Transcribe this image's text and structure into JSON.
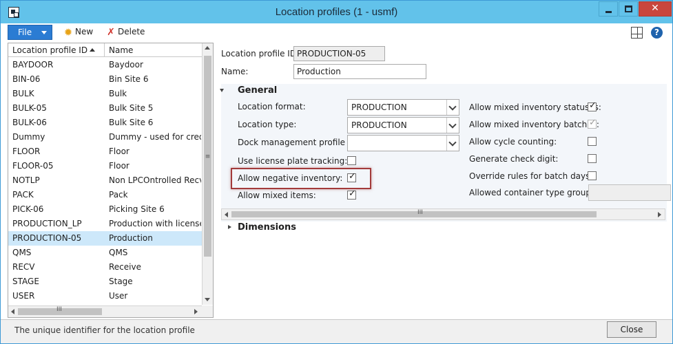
{
  "window": {
    "title": "Location profiles (1 - usmf)",
    "controls": {
      "close_symbol": "✕"
    }
  },
  "toolbar": {
    "file_label": "File",
    "new_label": "New",
    "delete_label": "Delete",
    "new_icon": "sun-icon",
    "delete_icon": "x-icon",
    "help_symbol": "?"
  },
  "list": {
    "columns": [
      "Location profile ID",
      "Name"
    ],
    "selected_index": 13,
    "rows": [
      {
        "id": "BAYDOOR",
        "name": "Baydoor"
      },
      {
        "id": "BIN-06",
        "name": "Bin Site 6"
      },
      {
        "id": "BULK",
        "name": "Bulk"
      },
      {
        "id": "BULK-05",
        "name": "Bulk Site 5"
      },
      {
        "id": "BULK-06",
        "name": "Bulk Site 6"
      },
      {
        "id": "Dummy",
        "name": "Dummy - used for credit d"
      },
      {
        "id": "FLOOR",
        "name": "Floor"
      },
      {
        "id": "FLOOR-05",
        "name": "Floor"
      },
      {
        "id": "NOTLP",
        "name": "Non LPCOntrolled Recv L"
      },
      {
        "id": "PACK",
        "name": "Pack"
      },
      {
        "id": "PICK-06",
        "name": "Picking Site 6"
      },
      {
        "id": "PRODUCTION_LP",
        "name": "Production with license p"
      },
      {
        "id": "PRODUCTION-05",
        "name": "Production"
      },
      {
        "id": "QMS",
        "name": "QMS"
      },
      {
        "id": "RECV",
        "name": "Receive"
      },
      {
        "id": "STAGE",
        "name": "Stage"
      },
      {
        "id": "USER",
        "name": "User"
      }
    ],
    "vscroll_grip": "≡",
    "hscroll_grip": "III"
  },
  "detail": {
    "profile_id_label": "Location profile ID:",
    "profile_id_value": "PRODUCTION-05",
    "name_label": "Name:",
    "name_value": "Production",
    "general": {
      "title": "General",
      "location_format_label": "Location format:",
      "location_format_value": "PRODUCTION",
      "location_type_label": "Location type:",
      "location_type_value": "PRODUCTION",
      "dock_label": "Dock management profile ID:",
      "dock_value": "",
      "license_plate_label": "Use license plate tracking:",
      "license_plate_checked": false,
      "negative_inventory_label": "Allow negative inventory:",
      "negative_inventory_checked": true,
      "mixed_items_label": "Allow mixed items:",
      "mixed_items_checked": true,
      "mixed_statuses_label": "Allow mixed  inventory statuses:",
      "mixed_statuses_checked": true,
      "mixed_batches_label": "Allow mixed inventory batches:",
      "mixed_batches_checked": true,
      "cycle_counting_label": "Allow cycle counting:",
      "cycle_counting_checked": false,
      "check_digit_label": "Generate check digit:",
      "check_digit_checked": false,
      "override_batch_label": "Override rules for batch days:",
      "override_batch_checked": false,
      "container_group_label": "Allowed container type group:",
      "container_group_value": "",
      "check_symbol": "✓"
    },
    "dimensions_title": "Dimensions",
    "hscroll_grip": "III"
  },
  "status": {
    "text": "The unique identifier for the location profile",
    "close_label": "Close"
  }
}
